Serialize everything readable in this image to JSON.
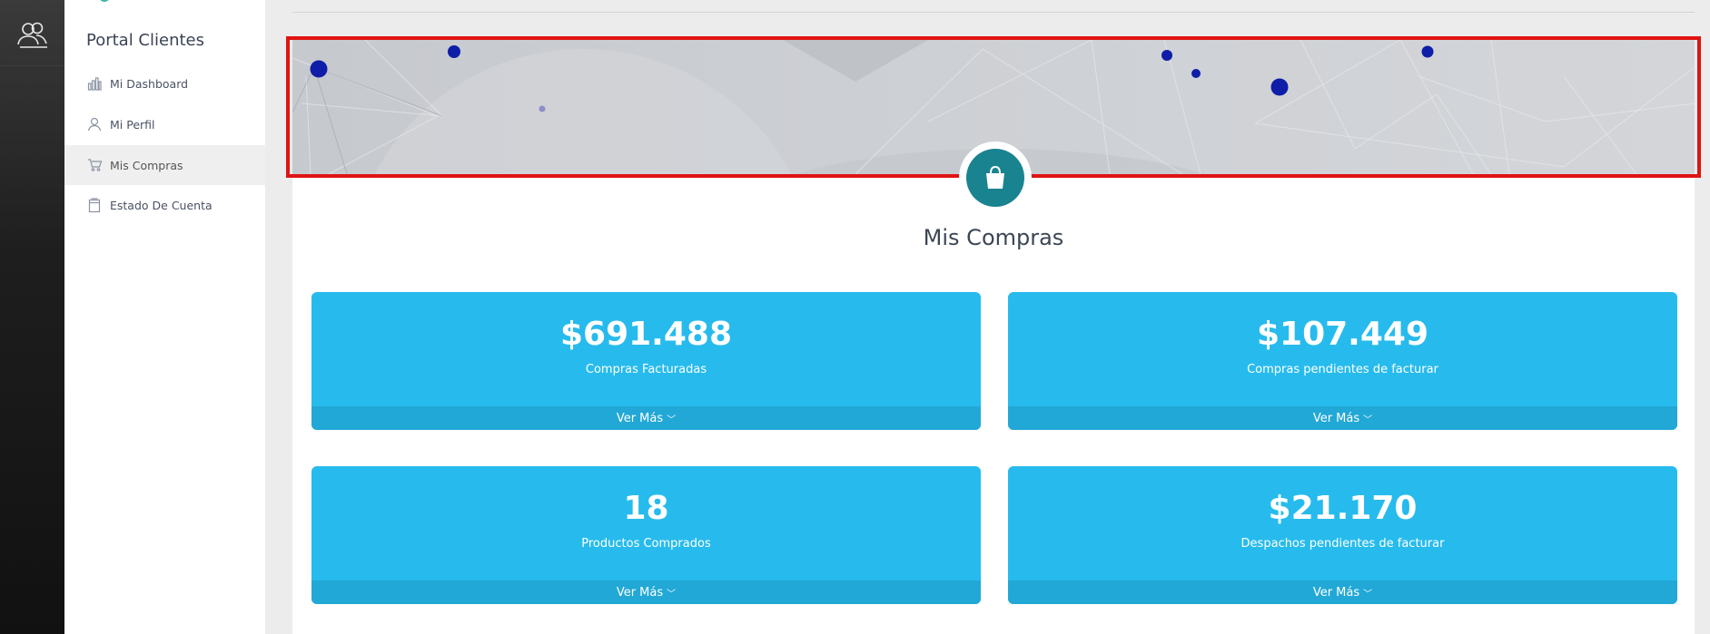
{
  "sidebar": {
    "title": "Portal Clientes",
    "items": [
      {
        "label": "Mi Dashboard",
        "icon": "bar-chart-icon"
      },
      {
        "label": "Mi Perfil",
        "icon": "user-icon"
      },
      {
        "label": "Mis Compras",
        "icon": "cart-icon",
        "active": true
      },
      {
        "label": "Estado De Cuenta",
        "icon": "document-icon"
      }
    ]
  },
  "main": {
    "section_title": "Mis Compras",
    "badge_icon": "shopping-bag-icon",
    "stats": [
      {
        "value": "$691.488",
        "caption": "Compras Facturadas",
        "more": "Ver Más"
      },
      {
        "value": "$107.449",
        "caption": "Compras pendientes de facturar",
        "more": "Ver Más"
      },
      {
        "value": "18",
        "caption": "Productos Comprados",
        "more": "Ver Más"
      },
      {
        "value": "$21.170",
        "caption": "Despachos pendientes de facturar",
        "more": "Ver Más"
      }
    ]
  },
  "colors": {
    "stat_card": "#27bbed",
    "stat_footer": "#22a8d6",
    "badge": "#1a8390",
    "highlight": "#e01313",
    "rail": "#111111"
  }
}
